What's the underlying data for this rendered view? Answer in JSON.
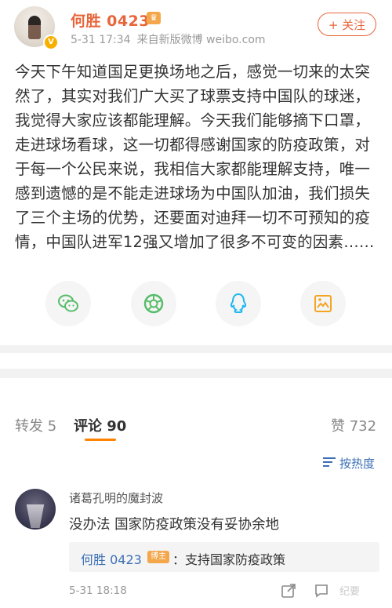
{
  "post": {
    "username": "何胜 0423",
    "time": "5-31 17:34",
    "source": "来自新版微博 weibo.com",
    "follow_label": "+ 关注",
    "text": "今天下午知道国足更换场地之后，感觉一切来的太突然了，其实对我们广大买了球票支持中国队的球迷，我觉得大家应该都能理解。今天我们能够摘下口罩，走进球场看球，这一切都得感谢国家的防疫政策，对于每一个公民来说，我相信大家都能理解支持，唯一感到遗憾的是不能走进球场为中国队加油，我们损失了三个主场的优势，还要面对迪拜一切不可预知的疫情，中国队进军12强又增加了很多不可变的因素……"
  },
  "share_icons": [
    "wechat-icon",
    "moments-icon",
    "qq-icon",
    "save-image-icon"
  ],
  "colors": {
    "accent": "#e8653a",
    "link": "#3b6fb6",
    "tab_underline": "#ff8200"
  },
  "tabs": {
    "repost": "转发 5",
    "comments": "评论 90",
    "likes": "赞 732"
  },
  "sort_label": "按热度",
  "comment": {
    "name": "诸葛孔明的魔封波",
    "text": "没办法 国家防疫政策没有妥协余地",
    "reply_name": "何胜 0423",
    "reply_tag": "博主",
    "reply_text": "：支持国家防疫政策",
    "time": "5-31 18:18"
  },
  "watermark": "纪要"
}
